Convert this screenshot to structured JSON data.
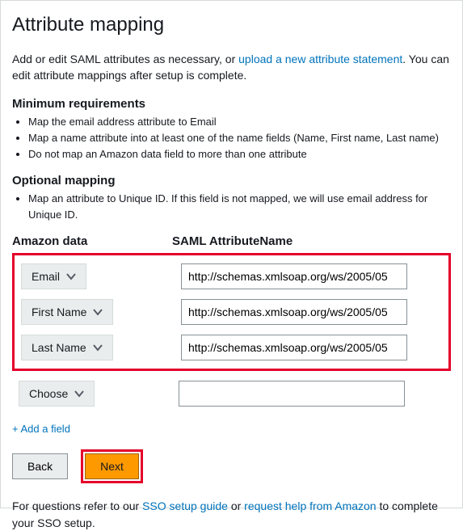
{
  "title": "Attribute mapping",
  "intro": {
    "pre": "Add or edit SAML attributes as necessary, or ",
    "link": "upload a new attribute statement",
    "post": ". You can edit attribute mappings after setup is complete."
  },
  "min_req": {
    "heading": "Minimum requirements",
    "items": [
      "Map the email address attribute to Email",
      "Map a name attribute into at least one of the name fields (Name, First name, Last name)",
      "Do not map an Amazon data field to more than one attribute"
    ]
  },
  "opt_map": {
    "heading": "Optional mapping",
    "items": [
      "Map an attribute to Unique ID. If this field is not mapped, we will use email address for Unique ID."
    ]
  },
  "columns": {
    "col1": "Amazon data",
    "col2": "SAML AttributeName"
  },
  "rows": [
    {
      "label": "Email",
      "value": "http://schemas.xmlsoap.org/ws/2005/05"
    },
    {
      "label": "First Name",
      "value": "http://schemas.xmlsoap.org/ws/2005/05"
    },
    {
      "label": "Last Name",
      "value": "http://schemas.xmlsoap.org/ws/2005/05"
    }
  ],
  "extra_row": {
    "label": "Choose",
    "value": ""
  },
  "add_field": "+ Add a field",
  "buttons": {
    "back": "Back",
    "next": "Next"
  },
  "footer": {
    "pre": "For questions refer to our ",
    "link1": "SSO setup guide",
    "mid": " or ",
    "link2": "request help from Amazon",
    "post": " to complete your SSO setup."
  }
}
